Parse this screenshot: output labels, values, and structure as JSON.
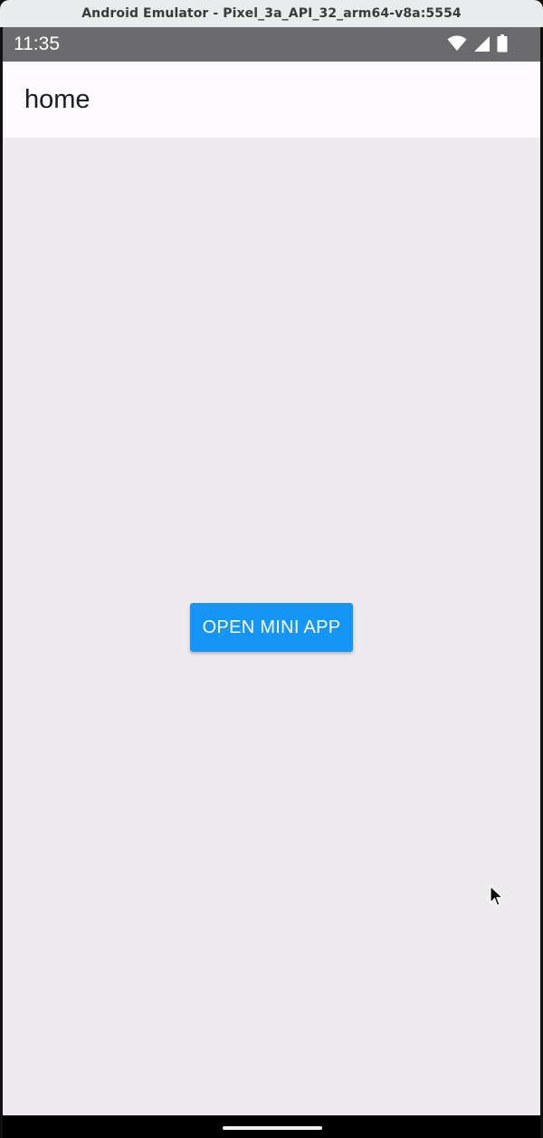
{
  "window": {
    "title": "Android Emulator - Pixel_3a_API_32_arm64-v8a:5554"
  },
  "status_bar": {
    "time": "11:35",
    "icons": [
      "wifi-icon",
      "cellular-signal-icon",
      "battery-icon"
    ]
  },
  "app_bar": {
    "title": "home"
  },
  "main": {
    "open_button_label": "OPEN MINI APP"
  },
  "colors": {
    "accent": "#1595f6",
    "status_bar": "#6b6b6d",
    "app_bar": "#fcfafd",
    "background": "#edebed"
  }
}
